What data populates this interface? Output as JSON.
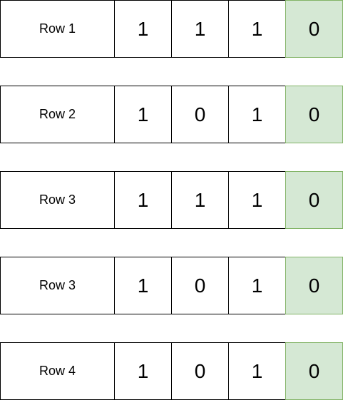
{
  "rows": [
    {
      "label": "Row 1",
      "bits": [
        "1",
        "1",
        "1"
      ],
      "result": "0"
    },
    {
      "label": "Row 2",
      "bits": [
        "1",
        "0",
        "1"
      ],
      "result": "0"
    },
    {
      "label": "Row 3",
      "bits": [
        "1",
        "1",
        "1"
      ],
      "result": "0"
    },
    {
      "label": "Row 3",
      "bits": [
        "1",
        "0",
        "1"
      ],
      "result": "0"
    },
    {
      "label": "Row 4",
      "bits": [
        "1",
        "0",
        "1"
      ],
      "result": "0"
    }
  ],
  "colors": {
    "cell_fill": "#ffffff",
    "cell_border": "#000000",
    "result_fill": "#d5e8d4",
    "result_border": "#82b366"
  }
}
